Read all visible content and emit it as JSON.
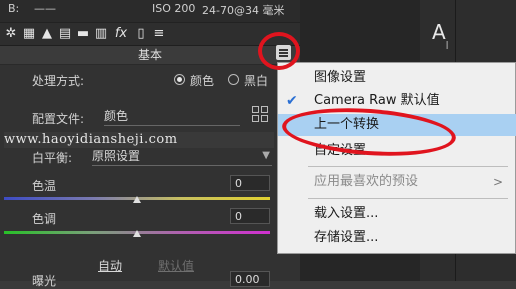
{
  "top_strip": {
    "b_label": "B:",
    "b_value": "——",
    "iso": "ISO 200",
    "focal": "24-70@34 毫米"
  },
  "section_title": "基本",
  "process": {
    "label": "处理方式:",
    "options": [
      "颜色",
      "黑白"
    ],
    "selected": "颜色"
  },
  "profile": {
    "label": "配置文件:",
    "value": "颜色"
  },
  "watermark": "www.haoyidiansheji.com",
  "white_balance": {
    "label": "白平衡:",
    "value": "原照设置"
  },
  "temperature": {
    "label": "色温",
    "value": "0",
    "level": 0.5
  },
  "tint": {
    "label": "色调",
    "value": "0",
    "level": 0.5
  },
  "links": {
    "auto": "自动",
    "default": "默认值"
  },
  "exposure": {
    "label": "曝光",
    "value": "0.00"
  },
  "right_tool": {
    "letter": "A",
    "sub": "|"
  },
  "menu": {
    "items": [
      {
        "label": "图像设置",
        "checked": false,
        "disabled": false,
        "highlighted": false
      },
      {
        "label": "Camera Raw 默认值",
        "checked": true,
        "disabled": false,
        "highlighted": false
      },
      {
        "label": "上一个转换",
        "checked": false,
        "disabled": false,
        "highlighted": true
      },
      {
        "label": "自定设置",
        "checked": false,
        "disabled": false,
        "highlighted": false
      },
      {
        "label": "应用最喜欢的预设",
        "checked": false,
        "disabled": true,
        "highlighted": false,
        "submenu": true
      },
      {
        "label": "载入设置...",
        "checked": false,
        "disabled": false,
        "highlighted": false
      },
      {
        "label": "存储设置...",
        "checked": false,
        "disabled": false,
        "highlighted": false
      }
    ]
  },
  "colors": {
    "annotation": "#e0141e",
    "highlight": "#a9d0f2",
    "check": "#2a6fd3"
  }
}
